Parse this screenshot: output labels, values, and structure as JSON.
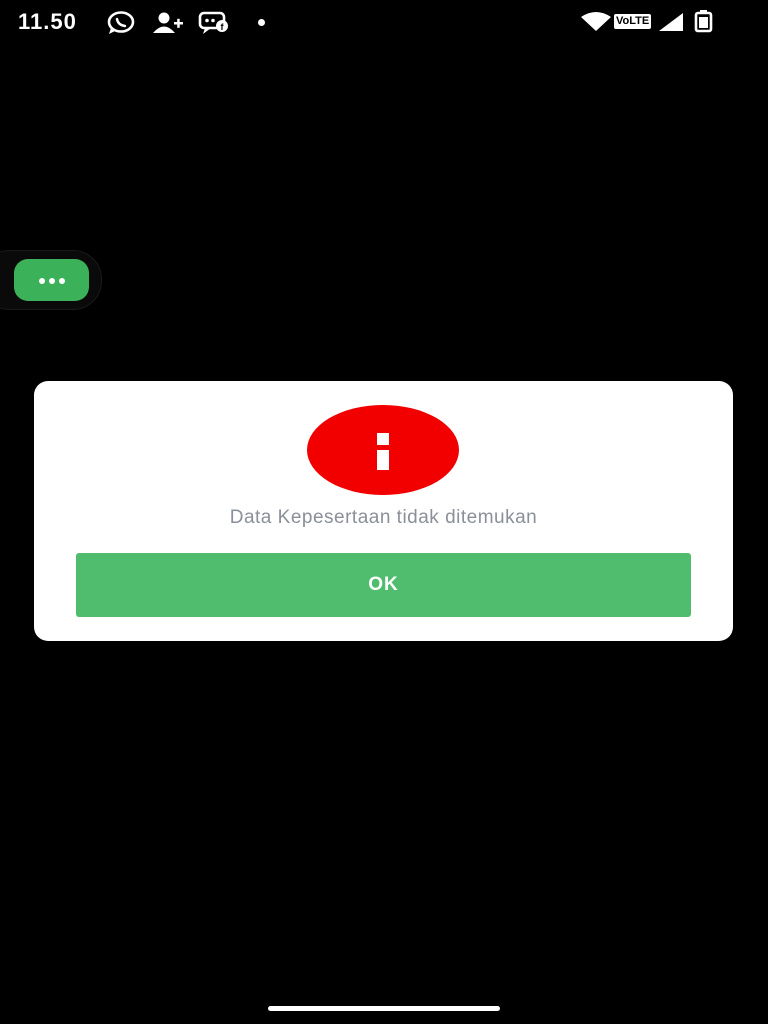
{
  "status_bar": {
    "time": "11.50",
    "network_label": "VoLTE",
    "icons": [
      "whatsapp-icon",
      "add-contact-icon",
      "chat-bubble-icon",
      "notification-dot-icon",
      "wifi-icon",
      "signal-icon",
      "battery-icon"
    ]
  },
  "floating_menu": {
    "icon": "more-horizontal-icon"
  },
  "dialog": {
    "icon": "info-icon",
    "icon_color": "#f20000",
    "message": "Data Kepesertaan tidak ditemukan",
    "ok_label": "OK",
    "button_color": "#4fbd6d"
  },
  "colors": {
    "background": "#000000",
    "accent_green": "#3bb15a"
  }
}
